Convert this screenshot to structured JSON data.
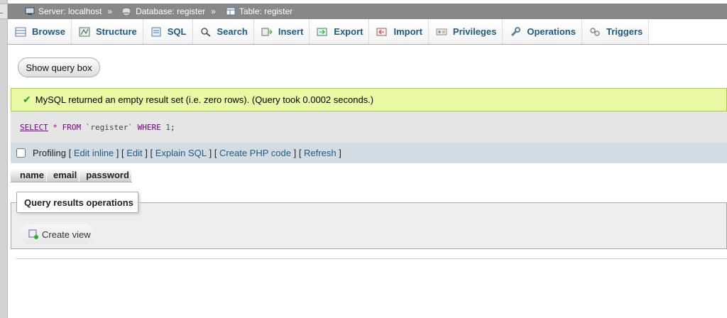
{
  "breadcrumb": {
    "server": "Server: localhost",
    "database": "Database: register",
    "table": "Table: register",
    "separator": "»",
    "collapse": "←"
  },
  "tabs": [
    {
      "label": "Browse",
      "icon": "browse-icon"
    },
    {
      "label": "Structure",
      "icon": "structure-icon"
    },
    {
      "label": "SQL",
      "icon": "sql-icon"
    },
    {
      "label": "Search",
      "icon": "search-icon"
    },
    {
      "label": "Insert",
      "icon": "insert-icon"
    },
    {
      "label": "Export",
      "icon": "export-icon"
    },
    {
      "label": "Import",
      "icon": "import-icon"
    },
    {
      "label": "Privileges",
      "icon": "privileges-icon"
    },
    {
      "label": "Operations",
      "icon": "operations-icon"
    },
    {
      "label": "Triggers",
      "icon": "triggers-icon"
    }
  ],
  "show_query_box": "Show query box",
  "message": "MySQL returned an empty result set (i.e. zero rows). (Query took 0.0002 seconds.)",
  "sql": {
    "select": "SELECT",
    "star": "*",
    "from": "FROM",
    "table": "`register`",
    "where": "WHERE",
    "value": "1",
    "end": ";"
  },
  "toolbar": {
    "profiling": "Profiling",
    "edit_inline": "Edit inline",
    "edit": "Edit",
    "explain_sql": "Explain SQL",
    "create_php": "Create PHP code",
    "refresh": "Refresh"
  },
  "columns": [
    "name",
    "email",
    "password"
  ],
  "operations": {
    "legend": "Query results operations",
    "create_view": "Create view"
  },
  "colors": {
    "topbar": "#888888",
    "success_bg": "#ebf8a4",
    "link": "#235a81",
    "toolbar_bg": "#d3dce3"
  }
}
